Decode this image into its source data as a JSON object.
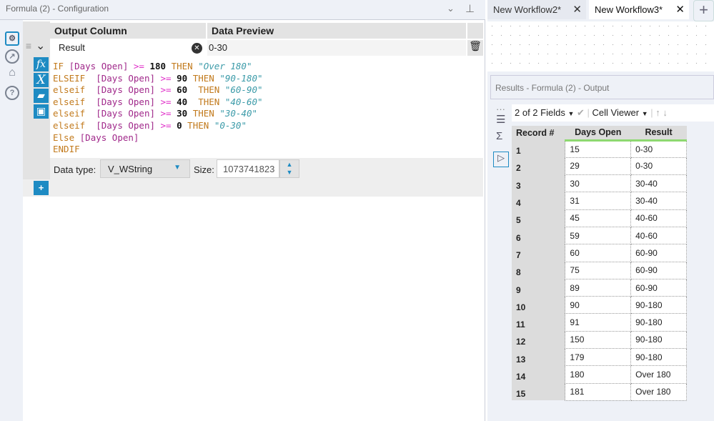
{
  "config": {
    "title": "Formula (2) - Configuration",
    "headers": {
      "output_column": "Output Column",
      "data_preview": "Data Preview"
    },
    "output_field": "Result",
    "preview": "0-30",
    "formula_lines": [
      [
        [
          "kw",
          "IF "
        ],
        [
          "fld",
          "[Days Open] "
        ],
        [
          "op",
          ">= "
        ],
        [
          "num",
          "180 "
        ],
        [
          "kw",
          "THEN "
        ],
        [
          "str",
          "\"Over 180\""
        ]
      ],
      [
        [
          "kw",
          "ELSEIF  "
        ],
        [
          "fld",
          "[Days Open] "
        ],
        [
          "op",
          ">= "
        ],
        [
          "num",
          "90 "
        ],
        [
          "kw",
          "THEN "
        ],
        [
          "str",
          "\"90-180\""
        ]
      ],
      [
        [
          "kw",
          "elseif  "
        ],
        [
          "fld",
          "[Days Open] "
        ],
        [
          "op",
          ">= "
        ],
        [
          "num",
          "60  "
        ],
        [
          "kw",
          "THEN "
        ],
        [
          "str",
          "\"60-90\""
        ]
      ],
      [
        [
          "kw",
          "elseif  "
        ],
        [
          "fld",
          "[Days Open] "
        ],
        [
          "op",
          ">= "
        ],
        [
          "num",
          "40  "
        ],
        [
          "kw",
          "THEN "
        ],
        [
          "str",
          "\"40-60\""
        ]
      ],
      [
        [
          "kw",
          "elseif  "
        ],
        [
          "fld",
          "[Days Open] "
        ],
        [
          "op",
          ">= "
        ],
        [
          "num",
          "30 "
        ],
        [
          "kw",
          "THEN "
        ],
        [
          "str",
          "\"30-40\""
        ]
      ],
      [
        [
          "kw",
          "elseif  "
        ],
        [
          "fld",
          "[Days Open] "
        ],
        [
          "op",
          ">= "
        ],
        [
          "num",
          "0 "
        ],
        [
          "kw",
          "THEN "
        ],
        [
          "str",
          "\"0-30\""
        ]
      ],
      [
        [
          "kw",
          "Else "
        ],
        [
          "fld",
          "[Days Open]"
        ]
      ],
      [
        [
          "kw",
          "ENDIF"
        ]
      ]
    ],
    "data_type_label": "Data type:",
    "data_type": "V_WString",
    "size_label": "Size:",
    "size": "1073741823"
  },
  "tabs": [
    {
      "label": "New Workflow2*"
    },
    {
      "label": "New Workflow3*"
    }
  ],
  "results": {
    "title": "Results - Formula (2) - Output",
    "fields": "2 of 2 Fields",
    "cell_viewer": "Cell Viewer",
    "columns": [
      "Record #",
      "Days Open",
      "Result"
    ],
    "rows": [
      [
        "1",
        "15",
        "0-30"
      ],
      [
        "2",
        "29",
        "0-30"
      ],
      [
        "3",
        "30",
        "30-40"
      ],
      [
        "4",
        "31",
        "30-40"
      ],
      [
        "5",
        "45",
        "40-60"
      ],
      [
        "6",
        "59",
        "40-60"
      ],
      [
        "7",
        "60",
        "60-90"
      ],
      [
        "8",
        "75",
        "60-90"
      ],
      [
        "9",
        "89",
        "60-90"
      ],
      [
        "10",
        "90",
        "90-180"
      ],
      [
        "11",
        "91",
        "90-180"
      ],
      [
        "12",
        "150",
        "90-180"
      ],
      [
        "13",
        "179",
        "90-180"
      ],
      [
        "14",
        "180",
        "Over 180"
      ],
      [
        "15",
        "181",
        "Over 180"
      ]
    ]
  }
}
